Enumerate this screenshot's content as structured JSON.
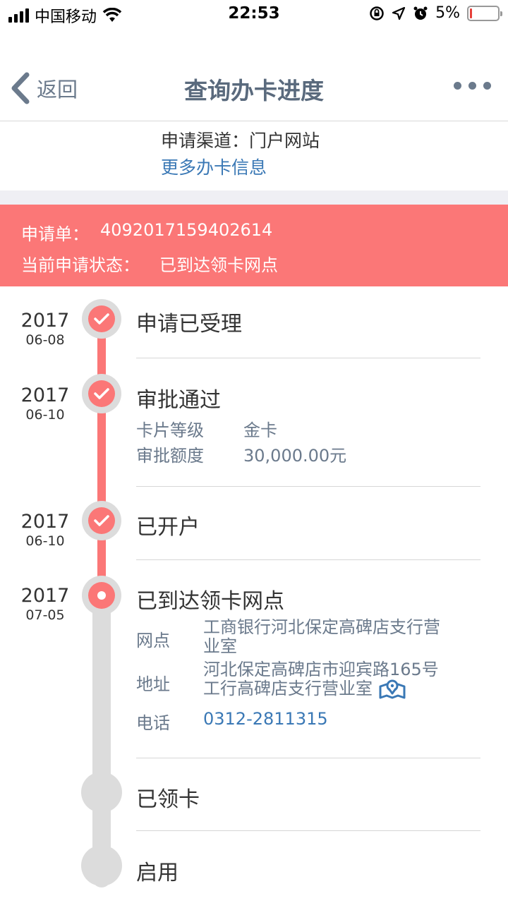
{
  "status_bar": {
    "carrier": "中国移动",
    "time": "22:53",
    "battery": "5%"
  },
  "nav": {
    "back_label": "返回",
    "title": "查询办卡进度"
  },
  "info": {
    "channel": "申请渠道：门户网站",
    "more_link": "更多办卡信息"
  },
  "banner": {
    "order_label": "申请单：",
    "order_value": "4092017159402614",
    "status_label": "当前申请状态：",
    "status_value": "已到达领卡网点"
  },
  "steps": [
    {
      "year": "2017",
      "date": "06-08",
      "title": "申请已受理"
    },
    {
      "year": "2017",
      "date": "06-10",
      "title": "审批通过",
      "details": [
        {
          "label": "卡片等级",
          "value": "金卡"
        },
        {
          "label": "审批额度",
          "value": "30,000.00元"
        }
      ]
    },
    {
      "year": "2017",
      "date": "06-10",
      "title": "已开户"
    },
    {
      "year": "2017",
      "date": "07-05",
      "title": "已到达领卡网点",
      "details": [
        {
          "label": "网点",
          "value_line1": "工商银行河北保定高碑店支行营",
          "value_line2": "业室"
        },
        {
          "label": "地址",
          "value_line1": "河北保定高碑店市迎宾路165号",
          "value_line2": "工行高碑店支行营业室"
        },
        {
          "label": "电话",
          "value": "0312-2811315"
        }
      ]
    },
    {
      "title": "已领卡"
    },
    {
      "title": "启用"
    }
  ],
  "colors": {
    "accent": "#fb7777",
    "link": "#3a78b5",
    "track": "#dcdcdc"
  },
  "icons": {
    "check": "check-icon",
    "map": "map-location-icon"
  }
}
